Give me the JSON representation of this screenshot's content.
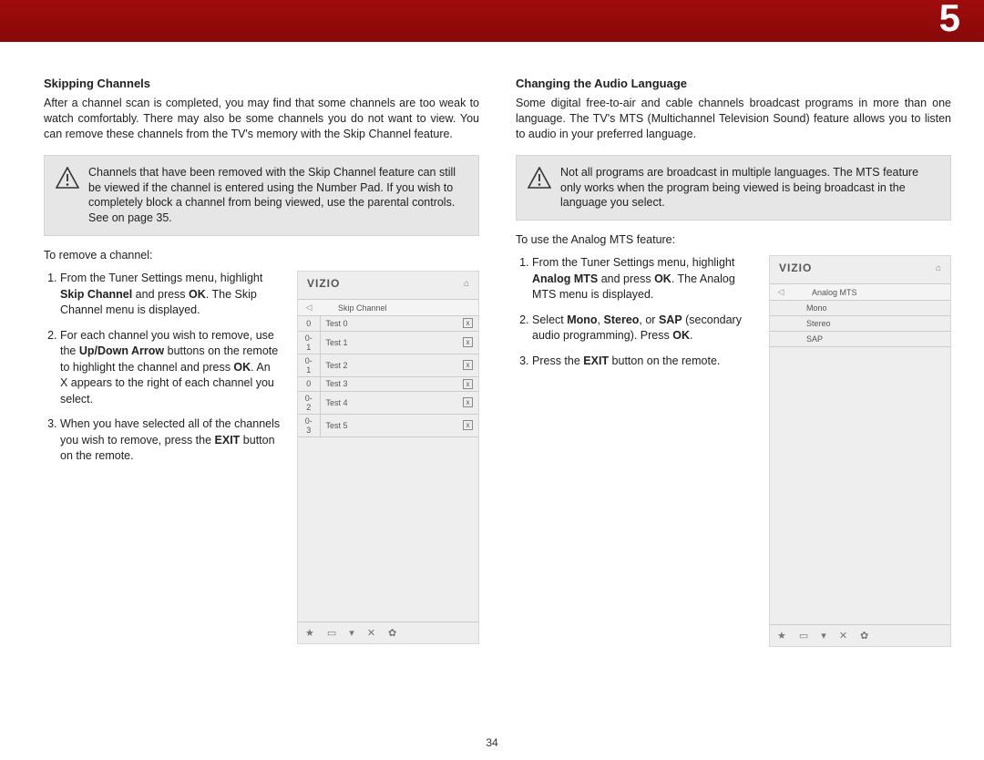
{
  "chapter": "5",
  "pageNumber": "34",
  "left": {
    "heading": "Skipping Channels",
    "intro": "After a channel scan is completed, you may find that some channels are too weak to watch comfortably. There may also be some channels you do not want to view. You can remove these channels from the TV's memory with the Skip Channel feature.",
    "notice": "Channels that have been removed with the Skip Channel feature can still be viewed if the channel is entered using the Number Pad. If you wish to completely block a channel from being viewed, use the parental controls. See  on page 35.",
    "lead": "To remove a channel:",
    "steps": {
      "s1a": "From the Tuner Settings menu, highlight ",
      "s1b": "Skip Channel",
      "s1c": " and press ",
      "s1d": "OK",
      "s1e": ". The Skip Channel menu is displayed.",
      "s2a": "For each channel you wish to remove, use the ",
      "s2b": "Up/Down Arrow",
      "s2c": " buttons on the remote to highlight the channel and press ",
      "s2d": "OK",
      "s2e": ". An X appears to the right of each channel you select.",
      "s3a": "When you have selected all of the channels you wish to remove, press the ",
      "s3b": "EXIT",
      "s3c": " button on the remote."
    },
    "osd": {
      "logo": "VIZIO",
      "title": "Skip Channel",
      "rows": [
        {
          "ch": "0",
          "name": "Test 0"
        },
        {
          "ch": "0-1",
          "name": "Test 1"
        },
        {
          "ch": "0-1",
          "name": "Test 2"
        },
        {
          "ch": "0",
          "name": "Test 3"
        },
        {
          "ch": "0-2",
          "name": "Test 4"
        },
        {
          "ch": "0-3",
          "name": "Test 5"
        }
      ]
    }
  },
  "right": {
    "heading": "Changing the Audio Language",
    "intro": "Some digital free-to-air and cable channels broadcast programs in more than one language. The TV's MTS (Multichannel Television Sound) feature allows you to listen to audio in your preferred language.",
    "notice": "Not all programs are broadcast in multiple languages. The MTS feature only works when the program being viewed is being broadcast in the language you select.",
    "lead": "To use the Analog MTS feature:",
    "steps": {
      "s1a": "From the Tuner Settings menu, highlight ",
      "s1b": "Analog MTS",
      "s1c": " and press ",
      "s1d": "OK",
      "s1e": ". The Analog MTS menu is displayed.",
      "s2a": "Select ",
      "s2b": "Mono",
      "s2c": ", ",
      "s2d": "Stereo",
      "s2e": ", or ",
      "s2f": "SAP",
      "s2g": " (secondary audio programming). Press ",
      "s2h": "OK",
      "s2i": ".",
      "s3a": "Press the ",
      "s3b": "EXIT",
      "s3c": " button on the remote."
    },
    "osd": {
      "logo": "VIZIO",
      "title": "Analog MTS",
      "opts": [
        "Mono",
        "Stereo",
        "SAP"
      ]
    }
  },
  "footerIcons": [
    "★",
    "▭",
    "▾",
    "✕",
    "✿"
  ]
}
